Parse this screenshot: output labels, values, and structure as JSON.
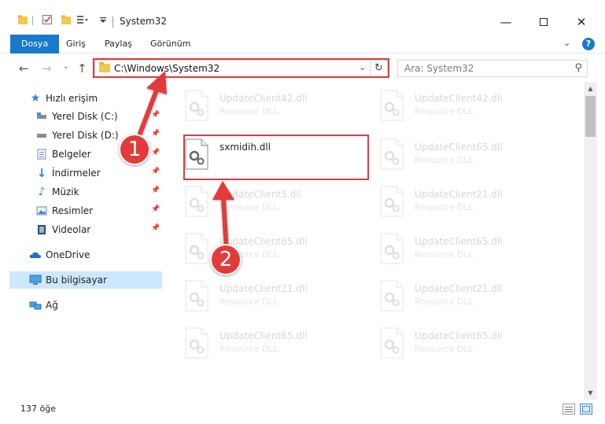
{
  "window": {
    "title": "System32",
    "minimize_icon": "minimize-icon",
    "maximize_icon": "maximize-icon",
    "close_icon": "close-icon"
  },
  "ribbon": {
    "tabs": [
      {
        "label": "Dosya"
      },
      {
        "label": "Giriş"
      },
      {
        "label": "Paylaş"
      },
      {
        "label": "Görünüm"
      }
    ],
    "help_label": "?"
  },
  "nav": {
    "address": "C:\\Windows\\System32",
    "search_placeholder": "Ara: System32"
  },
  "sidebar": {
    "items": [
      {
        "label": "Hızlı erişim"
      },
      {
        "label": "Yerel Disk (C:)"
      },
      {
        "label": "Yerel Disk (D:)"
      },
      {
        "label": "Belgeler"
      },
      {
        "label": "İndirmeler"
      },
      {
        "label": "Müzik"
      },
      {
        "label": "Resimler"
      },
      {
        "label": "Videolar"
      },
      {
        "label": "OneDrive"
      },
      {
        "label": "Bu bilgisayar"
      },
      {
        "label": "Ağ"
      }
    ]
  },
  "files": [
    {
      "name": "UpdateClient42.dll",
      "type": "Resource DLL"
    },
    {
      "name": "UpdateClient42.dll",
      "type": "Resource DLL"
    },
    {
      "name": "sxmidih.dll",
      "type": ""
    },
    {
      "name": "UpdateClient65.dll",
      "type": "Resource DLL"
    },
    {
      "name": "UpdateClient5.dll",
      "type": "Resource DLL"
    },
    {
      "name": "UpdateClient21.dll",
      "type": "Resource DLL"
    },
    {
      "name": "UpdateClient65.dll",
      "type": "Resource DLL"
    },
    {
      "name": "UpdateClient65.dll",
      "type": "Resource DLL"
    },
    {
      "name": "UpdateClient21.dll",
      "type": "Resource DLL"
    },
    {
      "name": "UpdateClient21.dll",
      "type": "Resource DLL"
    },
    {
      "name": "UpdateClient65.dll",
      "type": "Resource DLL"
    },
    {
      "name": "UpdateClient65.dll",
      "type": "Resource DLL"
    }
  ],
  "status": {
    "item_count": "137 öğe"
  },
  "annotations": {
    "step1": "1",
    "step2": "2"
  },
  "colors": {
    "accent": "#1979ca",
    "highlight_red": "#e03b3b",
    "selection": "#cce8ff"
  }
}
